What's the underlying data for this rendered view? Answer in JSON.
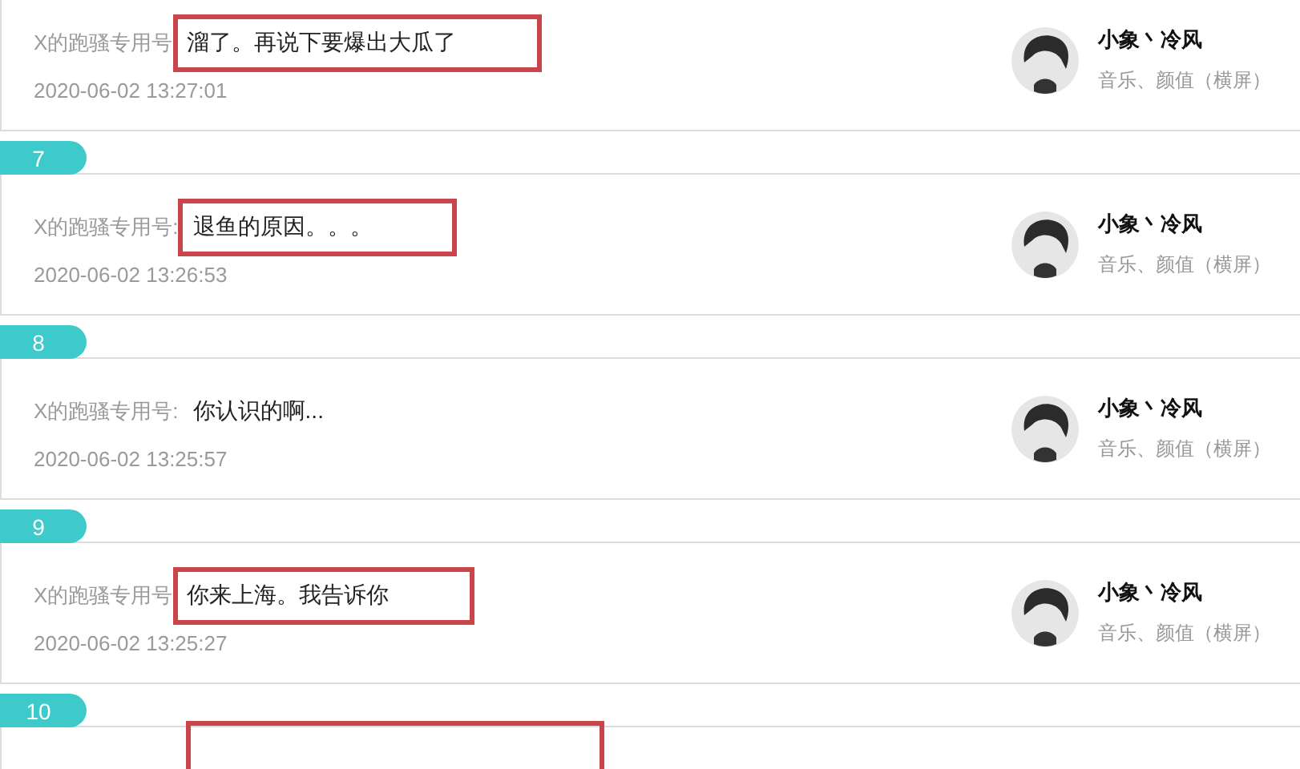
{
  "entries": [
    {
      "sender": "X的跑骚专用号",
      "message": "溜了。再说下要爆出大瓜了",
      "time": "2020-06-02 13:27:01",
      "highlighted": true,
      "author": {
        "name": "小象丶冷风",
        "tags": "音乐、颜值（横屏）"
      }
    },
    {
      "number": "7",
      "sender": "X的跑骚专用号:",
      "message": "退鱼的原因。。。",
      "time": "2020-06-02 13:26:53",
      "highlighted": true,
      "author": {
        "name": "小象丶冷风",
        "tags": "音乐、颜值（横屏）"
      }
    },
    {
      "number": "8",
      "sender": "X的跑骚专用号:",
      "message": "你认识的啊...",
      "time": "2020-06-02 13:25:57",
      "highlighted": false,
      "author": {
        "name": "小象丶冷风",
        "tags": "音乐、颜值（横屏）"
      }
    },
    {
      "number": "9",
      "sender": "X的跑骚专用号",
      "message": "你来上海。我告诉你",
      "time": "2020-06-02 13:25:27",
      "highlighted": true,
      "author": {
        "name": "小象丶冷风",
        "tags": "音乐、颜值（横屏）"
      }
    },
    {
      "number": "10",
      "highlighted": true
    }
  ]
}
